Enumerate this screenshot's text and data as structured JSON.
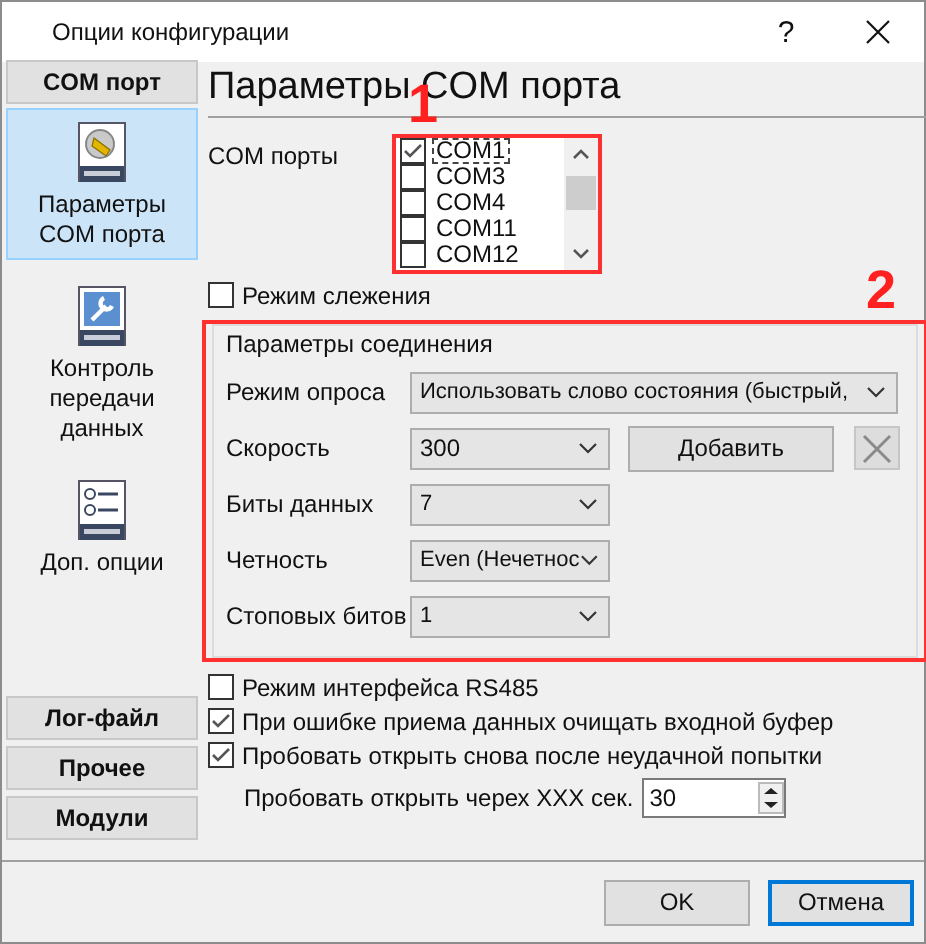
{
  "window": {
    "title": "Опции конфигурации",
    "help": "?"
  },
  "sidebar": {
    "header": "COM порт",
    "items": [
      {
        "label": "Параметры COM порта",
        "kind": "plug",
        "selected": true
      },
      {
        "label": "Контроль передачи данных",
        "kind": "wrench",
        "selected": false
      },
      {
        "label": "Доп. опции",
        "kind": "options",
        "selected": false
      }
    ],
    "buttons": [
      "Лог-файл",
      "Прочее",
      "Модули"
    ]
  },
  "page": {
    "heading": "Параметры COM порта",
    "com_ports_label": "COM порты",
    "com_ports": [
      {
        "name": "COM1",
        "checked": true,
        "selected": true
      },
      {
        "name": "COM3",
        "checked": false,
        "selected": false
      },
      {
        "name": "COM4",
        "checked": false,
        "selected": false
      },
      {
        "name": "COM11",
        "checked": false,
        "selected": false
      },
      {
        "name": "COM12",
        "checked": false,
        "selected": false
      }
    ],
    "monitor_mode": {
      "label": "Режим слежения",
      "checked": false
    },
    "connection": {
      "title": "Параметры соединения",
      "fields": [
        {
          "label": "Режим опроса",
          "value": "Использовать слово состояния (быстрый,",
          "kind": "wide"
        },
        {
          "label": "Скорость",
          "value": "300",
          "kind": "speed"
        },
        {
          "label": "Биты данных",
          "value": "7",
          "kind": "narrow"
        },
        {
          "label": "Четность",
          "value": "Even (Нечетнос",
          "kind": "narrow"
        },
        {
          "label": "Стоповых битов",
          "value": "1",
          "kind": "narrow"
        }
      ],
      "add_button": "Добавить"
    },
    "options": [
      {
        "label": "Режим интерфейса RS485",
        "checked": false
      },
      {
        "label": "При ошибке приема данных очищать входной буфер",
        "checked": true
      },
      {
        "label": "Пробовать открыть снова после неудачной попытки",
        "checked": true
      }
    ],
    "retry": {
      "label": "Пробовать открыть черех XXX сек.",
      "value": "30"
    }
  },
  "buttons": [
    {
      "label": "OK",
      "focused": false
    },
    {
      "label": "Отмена",
      "focused": true
    }
  ],
  "annotations": [
    {
      "label": "1"
    },
    {
      "label": "2"
    }
  ]
}
